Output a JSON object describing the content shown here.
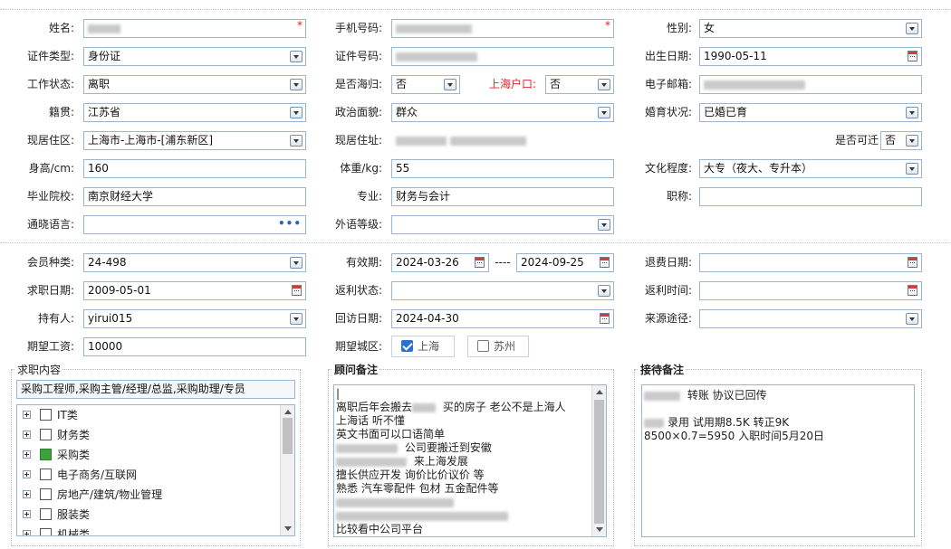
{
  "section1": {
    "name": {
      "label": "姓名:"
    },
    "phone": {
      "label": "手机号码:"
    },
    "gender": {
      "label": "性别:",
      "value": "女"
    },
    "id_type": {
      "label": "证件类型:",
      "value": "身份证"
    },
    "id_no": {
      "label": "证件号码:"
    },
    "birth": {
      "label": "出生日期:",
      "value": "1990-05-11"
    },
    "work_status": {
      "label": "工作状态:",
      "value": "离职"
    },
    "returnee": {
      "label": "是否海归:",
      "value": "否"
    },
    "sh_hukou": {
      "label": "上海户口:",
      "value": "否"
    },
    "email": {
      "label": "电子邮箱:"
    },
    "origin": {
      "label": "籍贯:",
      "value": "江苏省"
    },
    "politics": {
      "label": "政治面貌:",
      "value": "群众"
    },
    "marital": {
      "label": "婚育状况:",
      "value": "已婚已育"
    },
    "residence_area": {
      "label": "现居住区:",
      "value": "上海市-上海市-[浦东新区]"
    },
    "address": {
      "label": "现居住址:"
    },
    "can_move": {
      "label": "是否可迁",
      "value": "否"
    },
    "height": {
      "label": "身高/cm:",
      "value": "160"
    },
    "weight": {
      "label": "体重/kg:",
      "value": "55"
    },
    "education": {
      "label": "文化程度:",
      "value": "大专（夜大、专升本）"
    },
    "school": {
      "label": "毕业院校:",
      "value": "南京财经大学"
    },
    "major": {
      "label": "专业:",
      "value": "财务与会计"
    },
    "title": {
      "label": "职称:",
      "value": ""
    },
    "language": {
      "label": "通晓语言:",
      "ellipsis": "•••"
    },
    "foreign_level": {
      "label": "外语等级:",
      "value": ""
    }
  },
  "section2": {
    "member_type": {
      "label": "会员种类:",
      "value": "24-498"
    },
    "validity": {
      "label": "有效期:",
      "start": "2024-03-26",
      "sep": "----",
      "end": "2024-09-25"
    },
    "refund_date": {
      "label": "退费日期:",
      "value": ""
    },
    "job_date": {
      "label": "求职日期:",
      "value": "2009-05-01"
    },
    "rebate_status": {
      "label": "返利状态:",
      "value": ""
    },
    "rebate_time": {
      "label": "返利时间:",
      "value": ""
    },
    "holder": {
      "label": "持有人:",
      "value": "yirui015"
    },
    "visit_date": {
      "label": "回访日期:",
      "value": "2024-04-30"
    },
    "source": {
      "label": "来源途径:",
      "value": ""
    },
    "salary": {
      "label": "期望工资:",
      "value": "10000"
    },
    "city": {
      "label": "期望城区:",
      "options": [
        {
          "label": "上海",
          "checked": true
        },
        {
          "label": "苏州",
          "checked": false
        }
      ]
    }
  },
  "job_content": {
    "title": "求职内容",
    "selected_text": "采购工程师,采购主管/经理/总监,采购助理/专员",
    "tree": [
      {
        "label": "IT类",
        "checked": false
      },
      {
        "label": "财务类",
        "checked": false
      },
      {
        "label": "采购类",
        "checked": true
      },
      {
        "label": "电子商务/互联网",
        "checked": false
      },
      {
        "label": "房地产/建筑/物业管理",
        "checked": false
      },
      {
        "label": "服装类",
        "checked": false
      },
      {
        "label": "机械类",
        "checked": false
      }
    ]
  },
  "advisor_notes": {
    "title": "顾问备注",
    "lines": [
      {
        "text": "|"
      },
      {
        "pre": "离职后年会搬去",
        "blur": 26,
        "text": " 买的房子   老公不是上海人"
      },
      {
        "text": "上海话 听不懂"
      },
      {
        "text": "英文书面可以口语简单"
      },
      {
        "blur": 68,
        "text": " 公司要搬迁到安徽"
      },
      {
        "blur": 78,
        "text": "   来上海发展"
      },
      {
        "text": "擅长供应开发 询价比价议价 等"
      },
      {
        "text": "熟悉 汽车零配件 包材 五金配件等"
      },
      {
        "blur": 130,
        "text": ""
      },
      {
        "blur": 190,
        "text": ""
      },
      {
        "text": "比较看中公司平台"
      }
    ]
  },
  "reception_notes": {
    "title": "接待备注",
    "lines": [
      {
        "blur": 40,
        "text": "  转账 协议已回传"
      },
      {
        "text": ""
      },
      {
        "blur": 22,
        "text": "录用 试用期8.5K 转正9K"
      },
      {
        "text": "8500×0.7=5950  入职时间5月20日"
      }
    ]
  }
}
